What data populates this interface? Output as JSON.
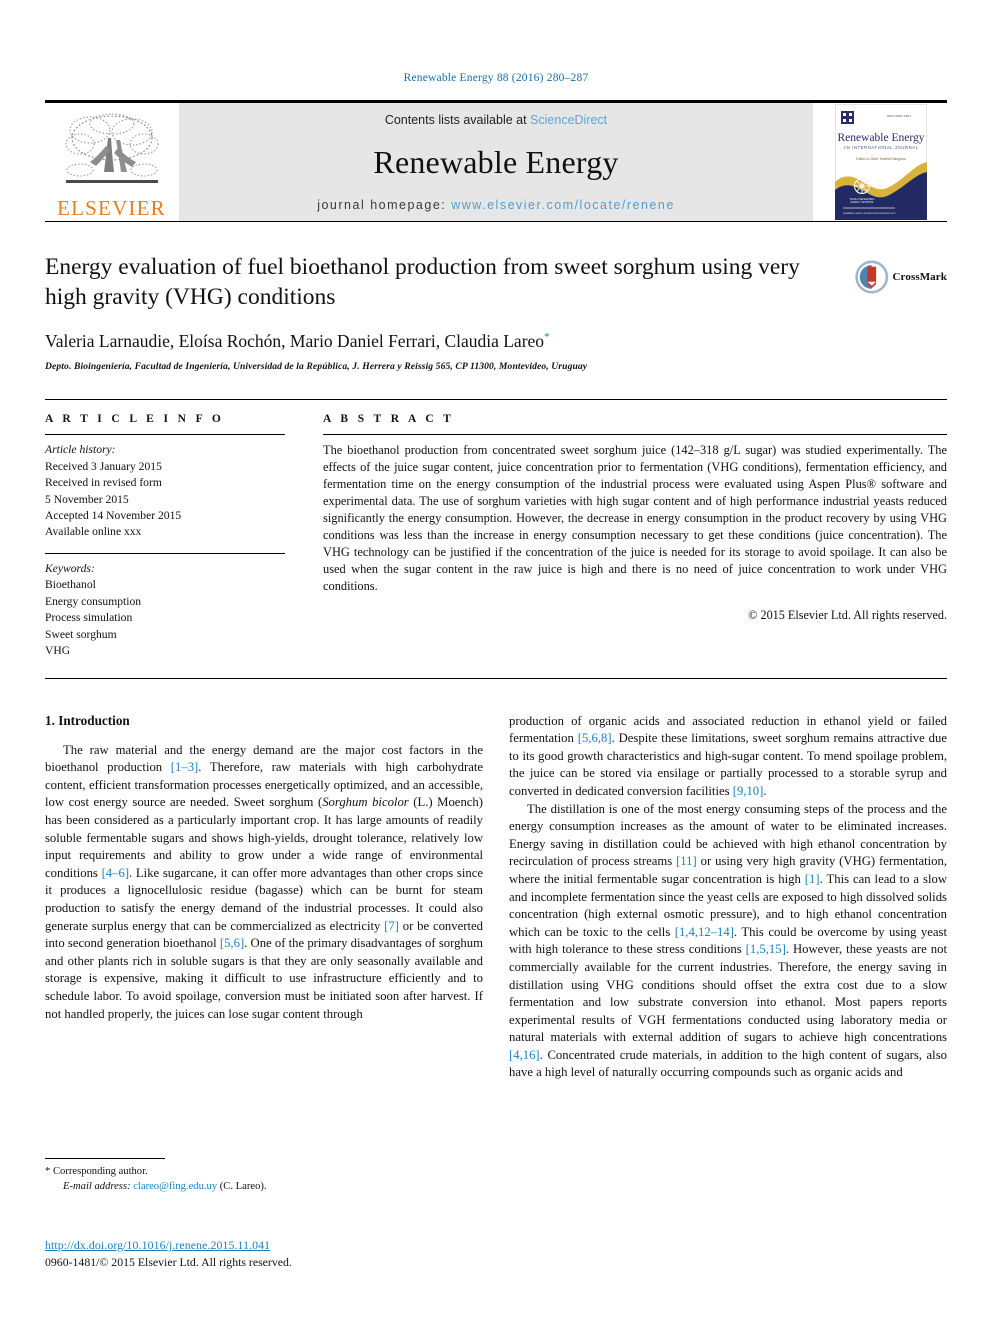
{
  "running_head": "Renewable Energy 88 (2016) 280–287",
  "masthead": {
    "publisher_name": "ELSEVIER",
    "contents_prefix": "Contents lists available at ",
    "contents_link": "ScienceDirect",
    "journal_name": "Renewable Energy",
    "homepage_prefix": "journal homepage: ",
    "homepage_url": "www.elsevier.com/locate/renene",
    "cover": {
      "title": "Renewable Energy",
      "subtitle": "AN INTERNATIONAL JOURNAL",
      "editor_line": "Editor-in-Chief: Soteris Kalogirou"
    },
    "accent_link_color": "#5aa7d4",
    "elsevier_orange": "#E87C1E"
  },
  "article": {
    "title": "Energy evaluation of fuel bioethanol production from sweet sorghum using very high gravity (VHG) conditions",
    "authors": "Valeria Larnaudie, Eloísa Rochón, Mario Daniel Ferrari, Claudia Lareo",
    "corresponding_marker": "*",
    "affiliation": "Depto. Bioingeniería, Facultad de Ingeniería, Universidad de la República, J. Herrera y Reissig 565, CP 11300, Montevideo, Uruguay",
    "crossmark_label": "CrossMark"
  },
  "article_info": {
    "heading": "A R T I C L E   I N F O",
    "history_label": "Article history:",
    "history": [
      "Received 3 January 2015",
      "Received in revised form",
      "5 November 2015",
      "Accepted 14 November 2015",
      "Available online xxx"
    ],
    "keywords_label": "Keywords:",
    "keywords": [
      "Bioethanol",
      "Energy consumption",
      "Process simulation",
      "Sweet sorghum",
      "VHG"
    ]
  },
  "abstract": {
    "heading": "A B S T R A C T",
    "text": "The bioethanol production from concentrated sweet sorghum juice (142–318 g/L sugar) was studied experimentally. The effects of the juice sugar content, juice concentration prior to fermentation (VHG conditions), fermentation efficiency, and fermentation time on the energy consumption of the industrial process were evaluated using Aspen Plus® software and experimental data. The use of sorghum varieties with high sugar content and of high performance industrial yeasts reduced significantly the energy consumption. However, the decrease in energy consumption in the product recovery by using VHG conditions was less than the increase in energy consumption necessary to get these conditions (juice concentration). The VHG technology can be justified if the concentration of the juice is needed for its storage to avoid spoilage. It can also be used when the sugar content in the raw juice is high and there is no need of juice concentration to work under VHG conditions.",
    "copyright": "© 2015 Elsevier Ltd. All rights reserved."
  },
  "body": {
    "section_title": "1. Introduction",
    "left_paragraph_1_a": "The raw material and the energy demand are the major cost factors in the bioethanol production ",
    "left_ref_1": "[1–3]",
    "left_paragraph_1_b": ". Therefore, raw materials with high carbohydrate content, efficient transformation processes energetically optimized, and an accessible, low cost energy source are needed. Sweet sorghum (",
    "left_italic_1": "Sorghum bicolor",
    "left_paragraph_1_c": " (L.) Moench) has been considered as a particularly important crop. It has large amounts of readily soluble fermentable sugars and shows high-yields, drought tolerance, relatively low input requirements and ability to grow under a wide range of environmental conditions ",
    "left_ref_2": "[4–6]",
    "left_paragraph_1_d": ". Like sugarcane, it can offer more advantages than other crops since it produces a lignocellulosic residue (bagasse) which can be burnt for steam production to satisfy the energy demand of the industrial processes. It could also generate surplus energy that can be commercialized as electricity ",
    "left_ref_3": "[7]",
    "left_paragraph_1_e": " or be converted into second generation bioethanol ",
    "left_ref_4": "[5,6]",
    "left_paragraph_1_f": ". One of the primary disadvantages of sorghum and other plants rich in soluble sugars is that they are only seasonally available and storage is expensive, making it difficult to use infrastructure efficiently and to schedule labor. To avoid spoilage, conversion must be initiated soon after harvest. If not handled properly, the juices can lose sugar content through",
    "right_paragraph_1_a": "production of organic acids and associated reduction in ethanol yield or failed fermentation ",
    "right_ref_1": "[5,6,8]",
    "right_paragraph_1_b": ". Despite these limitations, sweet sorghum remains attractive due to its good growth characteristics and high-sugar content. To mend spoilage problem, the juice can be stored via ensilage or partially processed to a storable syrup and converted in dedicated conversion facilities ",
    "right_ref_2": "[9,10]",
    "right_paragraph_1_c": ".",
    "right_paragraph_2_a": "The distillation is one of the most energy consuming steps of the process and the energy consumption increases as the amount of water to be eliminated increases. Energy saving in distillation could be achieved with high ethanol concentration by recirculation of process streams ",
    "right_ref_3": "[11]",
    "right_paragraph_2_b": " or using very high gravity (VHG) fermentation, where the initial fermentable sugar concentration is high ",
    "right_ref_4": "[1]",
    "right_paragraph_2_c": ". This can lead to a slow and incomplete fermentation since the yeast cells are exposed to high dissolved solids concentration (high external osmotic pressure), and to high ethanol concentration which can be toxic to the cells ",
    "right_ref_5": "[1,4,12–14]",
    "right_paragraph_2_d": ". This could be overcome by using yeast with high tolerance to these stress conditions ",
    "right_ref_6": "[1,5,15]",
    "right_paragraph_2_e": ". However, these yeasts are not commercially available for the current industries. Therefore, the energy saving in distillation using VHG conditions should offset the extra cost due to a slow fermentation and low substrate conversion into ethanol. Most papers reports experimental results of VGH fermentations conducted using laboratory media or natural materials with external addition of sugars to achieve high concentrations ",
    "right_ref_7": "[4,16]",
    "right_paragraph_2_f": ". Concentrated crude materials, in addition to the high content of sugars, also have a high level of naturally occurring compounds such as organic acids and"
  },
  "footnote": {
    "corresponding_marker": "*",
    "corresponding_text": "Corresponding author.",
    "email_label": "E-mail address:",
    "email": "clareo@fing.edu.uy",
    "email_attribution": "(C. Lareo)."
  },
  "page_footer": {
    "doi": "http://dx.doi.org/10.1016/j.renene.2015.11.041",
    "issn_copyright": "0960-1481/© 2015 Elsevier Ltd. All rights reserved."
  }
}
